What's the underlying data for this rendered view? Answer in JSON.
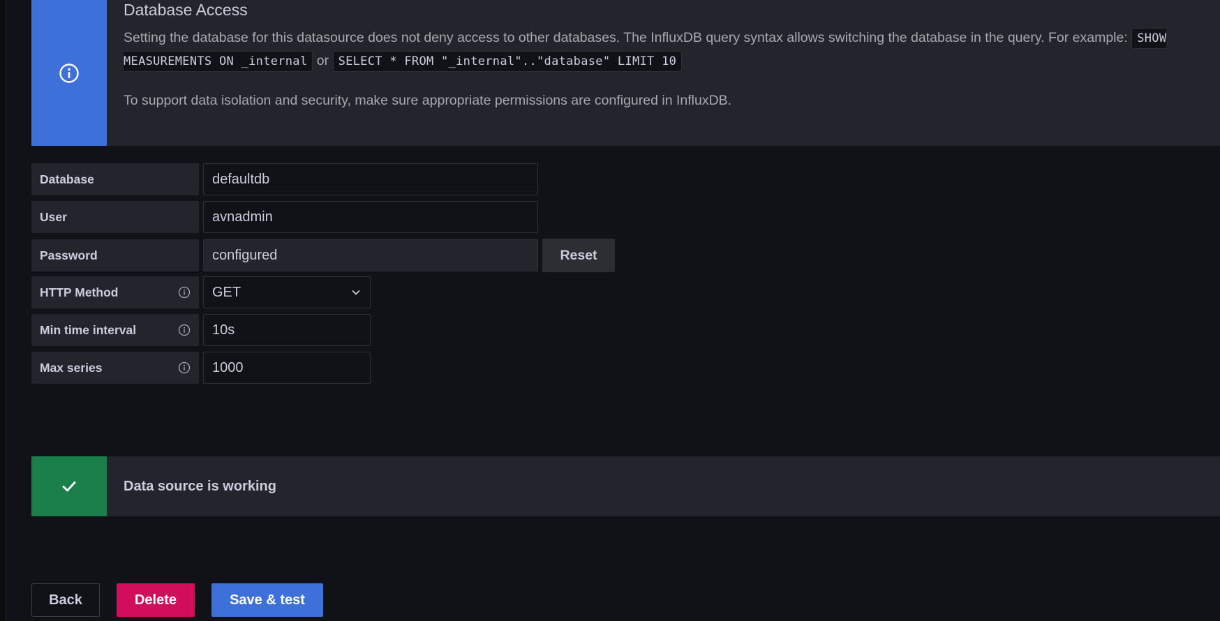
{
  "info_alert": {
    "title": "Database Access",
    "text_before": "Setting the database for this datasource does not deny access to other databases. The InfluxDB query syntax allows switching the database in the query. For example:",
    "code1": "SHOW MEASUREMENTS ON _internal",
    "or_word": "or",
    "code2": "SELECT * FROM \"_internal\"..\"database\" LIMIT 10",
    "text2": "To support data isolation and security, make sure appropriate permissions are configured in InfluxDB.",
    "icon": "info-circle-icon",
    "color": "#3d71d9"
  },
  "form": {
    "database": {
      "label": "Database",
      "value": "defaultdb"
    },
    "user": {
      "label": "User",
      "value": "avnadmin"
    },
    "password": {
      "label": "Password",
      "value": "configured",
      "reset_label": "Reset"
    },
    "http_method": {
      "label": "HTTP Method",
      "value": "GET"
    },
    "min_time_interval": {
      "label": "Min time interval",
      "value": "10s"
    },
    "max_series": {
      "label": "Max series",
      "value": "1000"
    }
  },
  "success_alert": {
    "text": "Data source is working",
    "icon": "check-icon",
    "color": "#1a7f4b"
  },
  "footer": {
    "back_label": "Back",
    "delete_label": "Delete",
    "save_label": "Save & test",
    "delete_color": "#d10e5c",
    "save_color": "#3d71d9"
  }
}
